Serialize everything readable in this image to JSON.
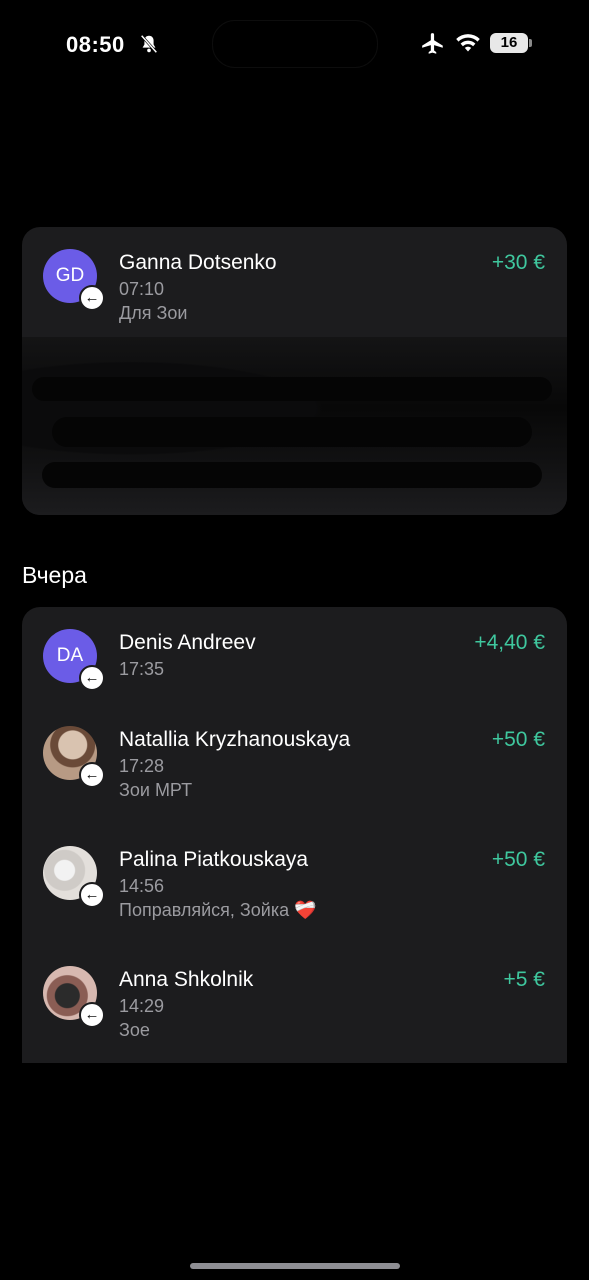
{
  "status_bar": {
    "time": "08:50",
    "battery_level": "16",
    "icons": [
      "bell-slash-icon",
      "airplane-icon",
      "wifi-icon",
      "battery-icon"
    ]
  },
  "colors": {
    "background": "#000000",
    "card": "#1c1c1e",
    "positive_amount": "#3fc79e",
    "avatar_initials_bg": "#6b5ce7",
    "secondary_text": "#9b9ba0"
  },
  "today": {
    "transactions": [
      {
        "initials": "GD",
        "name": "Ganna Dotsenko",
        "time": "07:10",
        "note": "Для Зои",
        "amount": "+30 €",
        "direction_icon": "incoming-arrow-icon"
      }
    ]
  },
  "yesterday": {
    "label": "Вчера",
    "transactions": [
      {
        "initials": "DA",
        "name": "Denis Andreev",
        "time": "17:35",
        "note": "",
        "amount": "+4,40 €"
      },
      {
        "initials": "",
        "name": "Natallia Kryzhanouskaya",
        "time": "17:28",
        "note": "Зои МРТ",
        "amount": "+50 €"
      },
      {
        "initials": "",
        "name": "Palina Piatkouskaya",
        "time": "14:56",
        "note": "Поправляйся, Зойка ❤️‍🩹",
        "amount": "+50 €"
      },
      {
        "initials": "",
        "name": "Anna Shkolnik",
        "time": "14:29",
        "note": "Зое",
        "amount": "+5 €"
      }
    ]
  },
  "badge_glyph": "←"
}
